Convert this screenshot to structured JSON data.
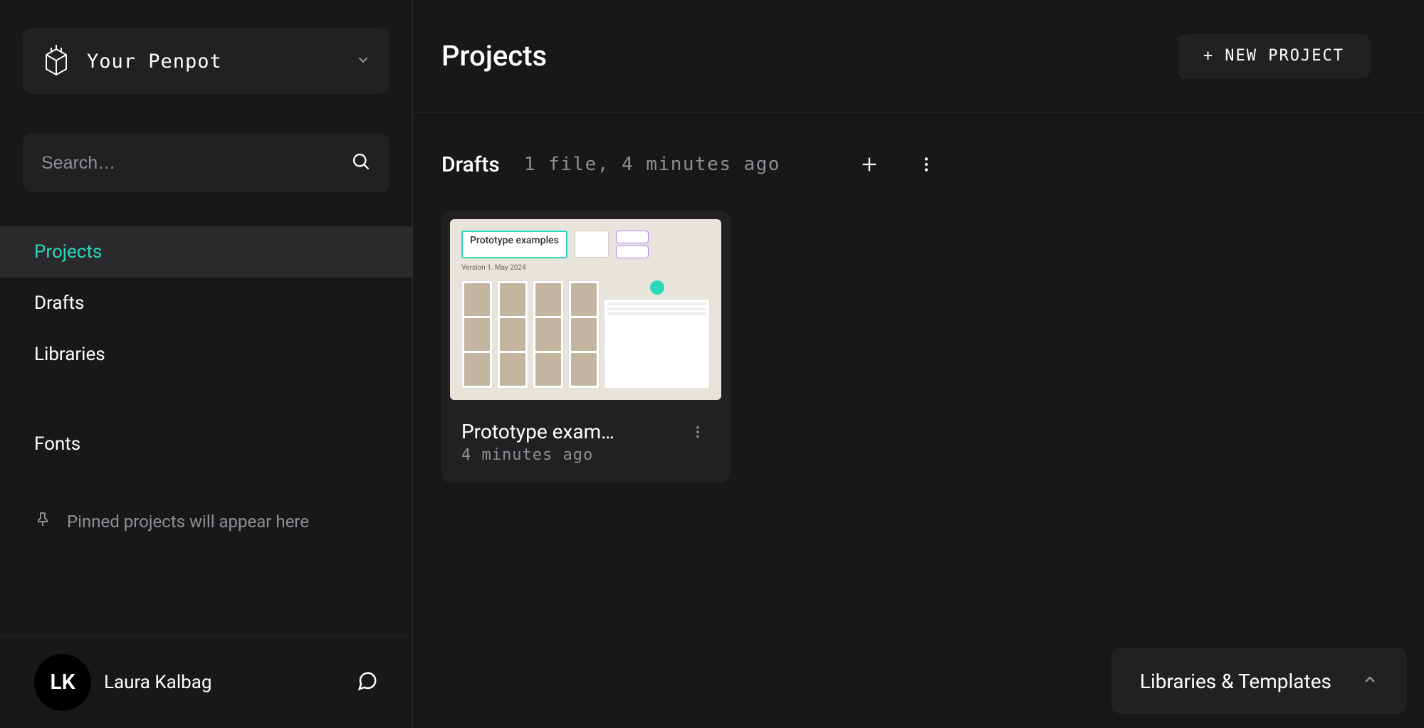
{
  "sidebar": {
    "workspace_name": "Your Penpot",
    "search_placeholder": "Search…",
    "nav": [
      {
        "label": "Projects",
        "active": true
      },
      {
        "label": "Drafts",
        "active": false
      },
      {
        "label": "Libraries",
        "active": false
      }
    ],
    "fonts_label": "Fonts",
    "pinned_hint": "Pinned projects will appear here"
  },
  "user": {
    "initials": "LK",
    "name": "Laura Kalbag"
  },
  "main": {
    "title": "Projects",
    "new_project_button": "+ NEW PROJECT",
    "section": {
      "title": "Drafts",
      "meta": "1 file, 4 minutes ago"
    },
    "file": {
      "title": "Prototype exam…",
      "time": "4 minutes ago",
      "thumb_title": "Prototype examples",
      "thumb_version": "Version 1. May 2024"
    },
    "libraries_toggle": "Libraries & Templates"
  }
}
